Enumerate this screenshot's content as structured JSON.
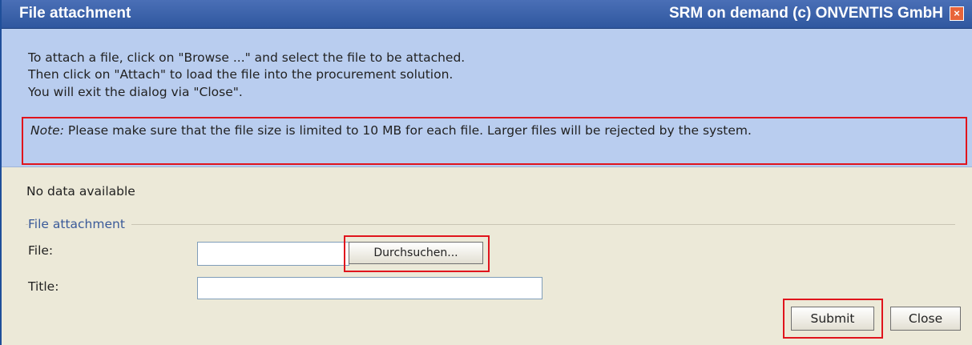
{
  "titlebar": {
    "title": "File attachment",
    "brand": "SRM on demand (c) ONVENTIS GmbH",
    "close_glyph": "×"
  },
  "info": {
    "lines": [
      "To attach a file, click on \"Browse ...\" and select the file to be attached.",
      "Then click on \"Attach\" to load the file into the procurement solution.",
      "You will exit the dialog via \"Close\"."
    ],
    "note_label": "Note:",
    "note_text": " Please make sure that the file size is limited to 10 MB for each file. Larger files will be rejected by the system."
  },
  "status": {
    "no_data": "No data available"
  },
  "form": {
    "legend": "File attachment",
    "file_label": "File:",
    "file_value": "",
    "browse_label": "Durchsuchen...",
    "title_label": "Title:",
    "title_value": ""
  },
  "buttons": {
    "submit": "Submit",
    "close": "Close"
  },
  "colors": {
    "titlebar": "#2f579f",
    "info_bg": "#b9cdef",
    "dialog_bg": "#ece9d8",
    "highlight": "#e0141c"
  },
  "icons": {
    "close": "close-icon"
  }
}
